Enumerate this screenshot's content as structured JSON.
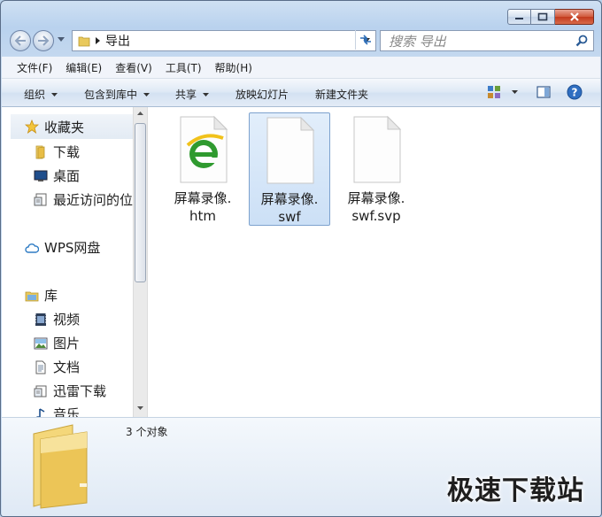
{
  "window": {
    "caption": {
      "minimize": "minimize",
      "maximize": "maximize",
      "close": "close"
    }
  },
  "address": {
    "current_folder": "导出",
    "search_placeholder": "搜索 导出"
  },
  "menu": [
    "文件(F)",
    "编辑(E)",
    "查看(V)",
    "工具(T)",
    "帮助(H)"
  ],
  "toolbar": {
    "organize": "组织",
    "include_in_library": "包含到库中",
    "share": "共享",
    "slideshow": "放映幻灯片",
    "new_folder": "新建文件夹"
  },
  "nav": {
    "favorites": "收藏夹",
    "downloads": "下载",
    "desktop": "桌面",
    "recent": "最近访问的位置",
    "wps": "WPS网盘",
    "libraries": "库",
    "videos": "视频",
    "pictures": "图片",
    "documents": "文档",
    "thunder": "迅雷下载",
    "music": "音乐"
  },
  "files": [
    {
      "line1": "屏幕录像.",
      "line2": "htm",
      "icon": "ie-html-file-icon",
      "selected": false
    },
    {
      "line1": "屏幕录像.",
      "line2": "swf",
      "icon": "blank-file-icon",
      "selected": true
    },
    {
      "line1": "屏幕录像.",
      "line2": "swf.svp",
      "icon": "blank-file-icon",
      "selected": false
    }
  ],
  "details": {
    "count": "3 个对象"
  },
  "watermark": "极速下载站",
  "colors": {
    "accent": "#3c7fb1",
    "selection": "#cce0f6",
    "close_button": "#c9432a"
  }
}
